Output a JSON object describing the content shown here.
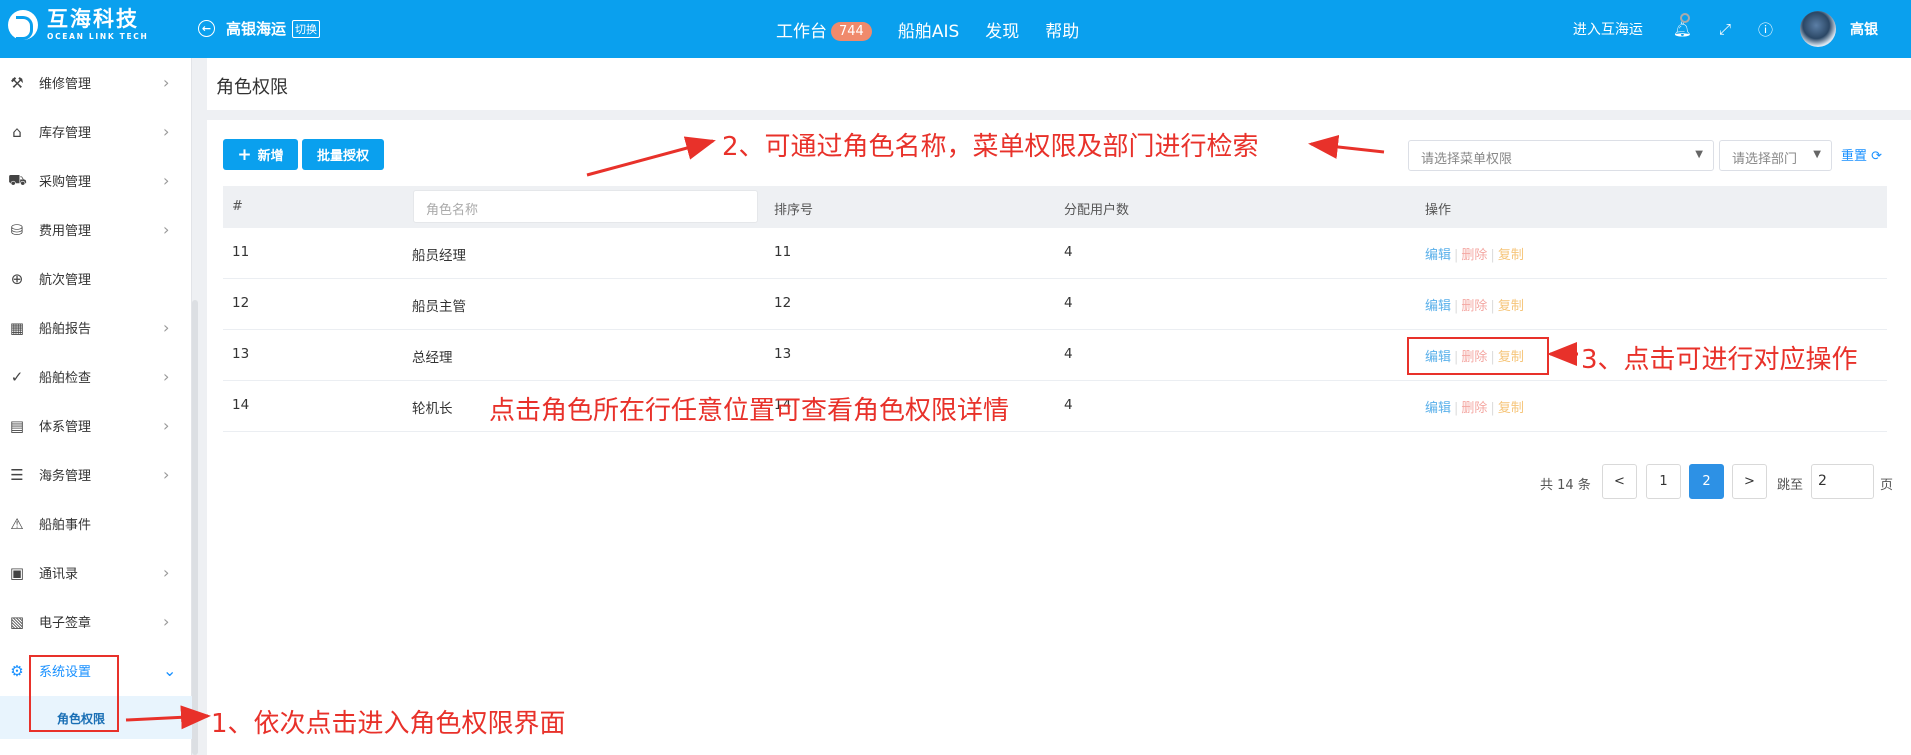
{
  "header": {
    "logo_cn": "互海科技",
    "logo_en": "OCEAN LINK TECH",
    "company": "高银海运",
    "switch_label": "切换",
    "nav": [
      {
        "label": "工作台",
        "badge": "744"
      },
      {
        "label": "船舶AIS"
      },
      {
        "label": "发现"
      },
      {
        "label": "帮助"
      }
    ],
    "enter_label": "进入互海运",
    "username": "高银"
  },
  "sidebar": {
    "items": [
      {
        "label": "维修管理",
        "icon": "wrench-icon"
      },
      {
        "label": "库存管理",
        "icon": "warehouse-icon"
      },
      {
        "label": "采购管理",
        "icon": "cart-icon"
      },
      {
        "label": "费用管理",
        "icon": "coins-icon"
      },
      {
        "label": "航次管理",
        "icon": "globe-icon"
      },
      {
        "label": "船舶报告",
        "icon": "calendar-icon"
      },
      {
        "label": "船舶检查",
        "icon": "check-circle-icon"
      },
      {
        "label": "体系管理",
        "icon": "clipboard-icon"
      },
      {
        "label": "海务管理",
        "icon": "signpost-icon"
      },
      {
        "label": "船舶事件",
        "icon": "warning-icon"
      },
      {
        "label": "通讯录",
        "icon": "address-book-icon"
      },
      {
        "label": "电子签章",
        "icon": "seal-icon"
      },
      {
        "label": "系统设置",
        "icon": "gear-icon"
      }
    ],
    "sub_active": "角色权限"
  },
  "page": {
    "title": "角色权限",
    "add_label": "新增",
    "batch_label": "批量授权",
    "menu_select_placeholder": "请选择菜单权限",
    "dept_select_placeholder": "请选择部门",
    "reset_label": "重置"
  },
  "table": {
    "headers": [
      "#",
      "排序号",
      "分配用户数",
      "操作"
    ],
    "name_filter_placeholder": "角色名称",
    "rows": [
      {
        "id": "11",
        "name": "船员经理",
        "order": "11",
        "users": "4"
      },
      {
        "id": "12",
        "name": "船员主管",
        "order": "12",
        "users": "4"
      },
      {
        "id": "13",
        "name": "总经理",
        "order": "13",
        "users": "4"
      },
      {
        "id": "14",
        "name": "轮机长",
        "order": "14",
        "users": "4"
      }
    ],
    "actions": {
      "edit": "编辑",
      "delete": "删除",
      "copy": "复制"
    }
  },
  "pagination": {
    "total_text": "共 14 条",
    "prev": "<",
    "pages": [
      "1",
      "2"
    ],
    "current": "2",
    "next": ">",
    "jump_label": "跳至",
    "jump_value": "2",
    "page_unit": "页"
  },
  "annotations": {
    "step1": "1、依次点击进入角色权限界面",
    "step2": "2、可通过角色名称，菜单权限及部门进行检索",
    "step3": "3、点击可进行对应操作",
    "note": "点击角色所在行任意位置可查看角色权限详情"
  },
  "colors": {
    "header_bg": "#0aa0ee",
    "primary": "#0aa0ee",
    "annotation": "#e8312a",
    "badge": "#f08a6c"
  }
}
